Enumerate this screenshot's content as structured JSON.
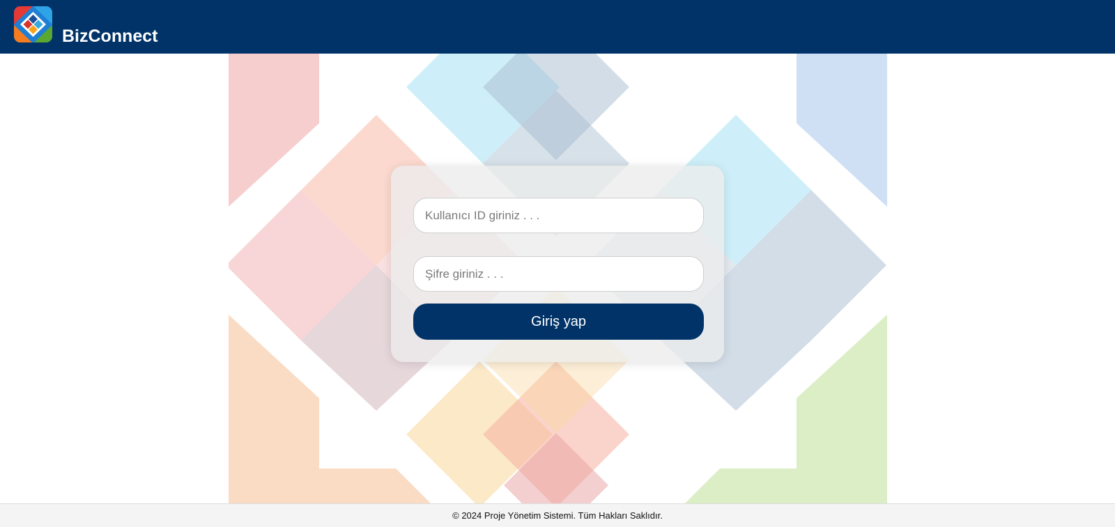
{
  "header": {
    "brand": "BizConnect",
    "background_color": "#013368",
    "logo_icon": "bizconnect-logo"
  },
  "background": {
    "pattern_icon": "diamond-mosaic-pattern",
    "colors": [
      "#f3b3b4",
      "#9edff3",
      "#a7bccf",
      "#bfd6f2",
      "#f9b9a8",
      "#f6c39c",
      "#f9d79a",
      "#c8e5a6"
    ]
  },
  "login": {
    "user_placeholder": "Kullanıcı ID giriniz . . .",
    "password_placeholder": "Şifre giriniz . . .",
    "submit_label": "Giriş yap",
    "button_color": "#013368"
  },
  "footer": {
    "text": "© 2024 Proje Yönetim Sistemi. Tüm Hakları Saklıdır."
  }
}
